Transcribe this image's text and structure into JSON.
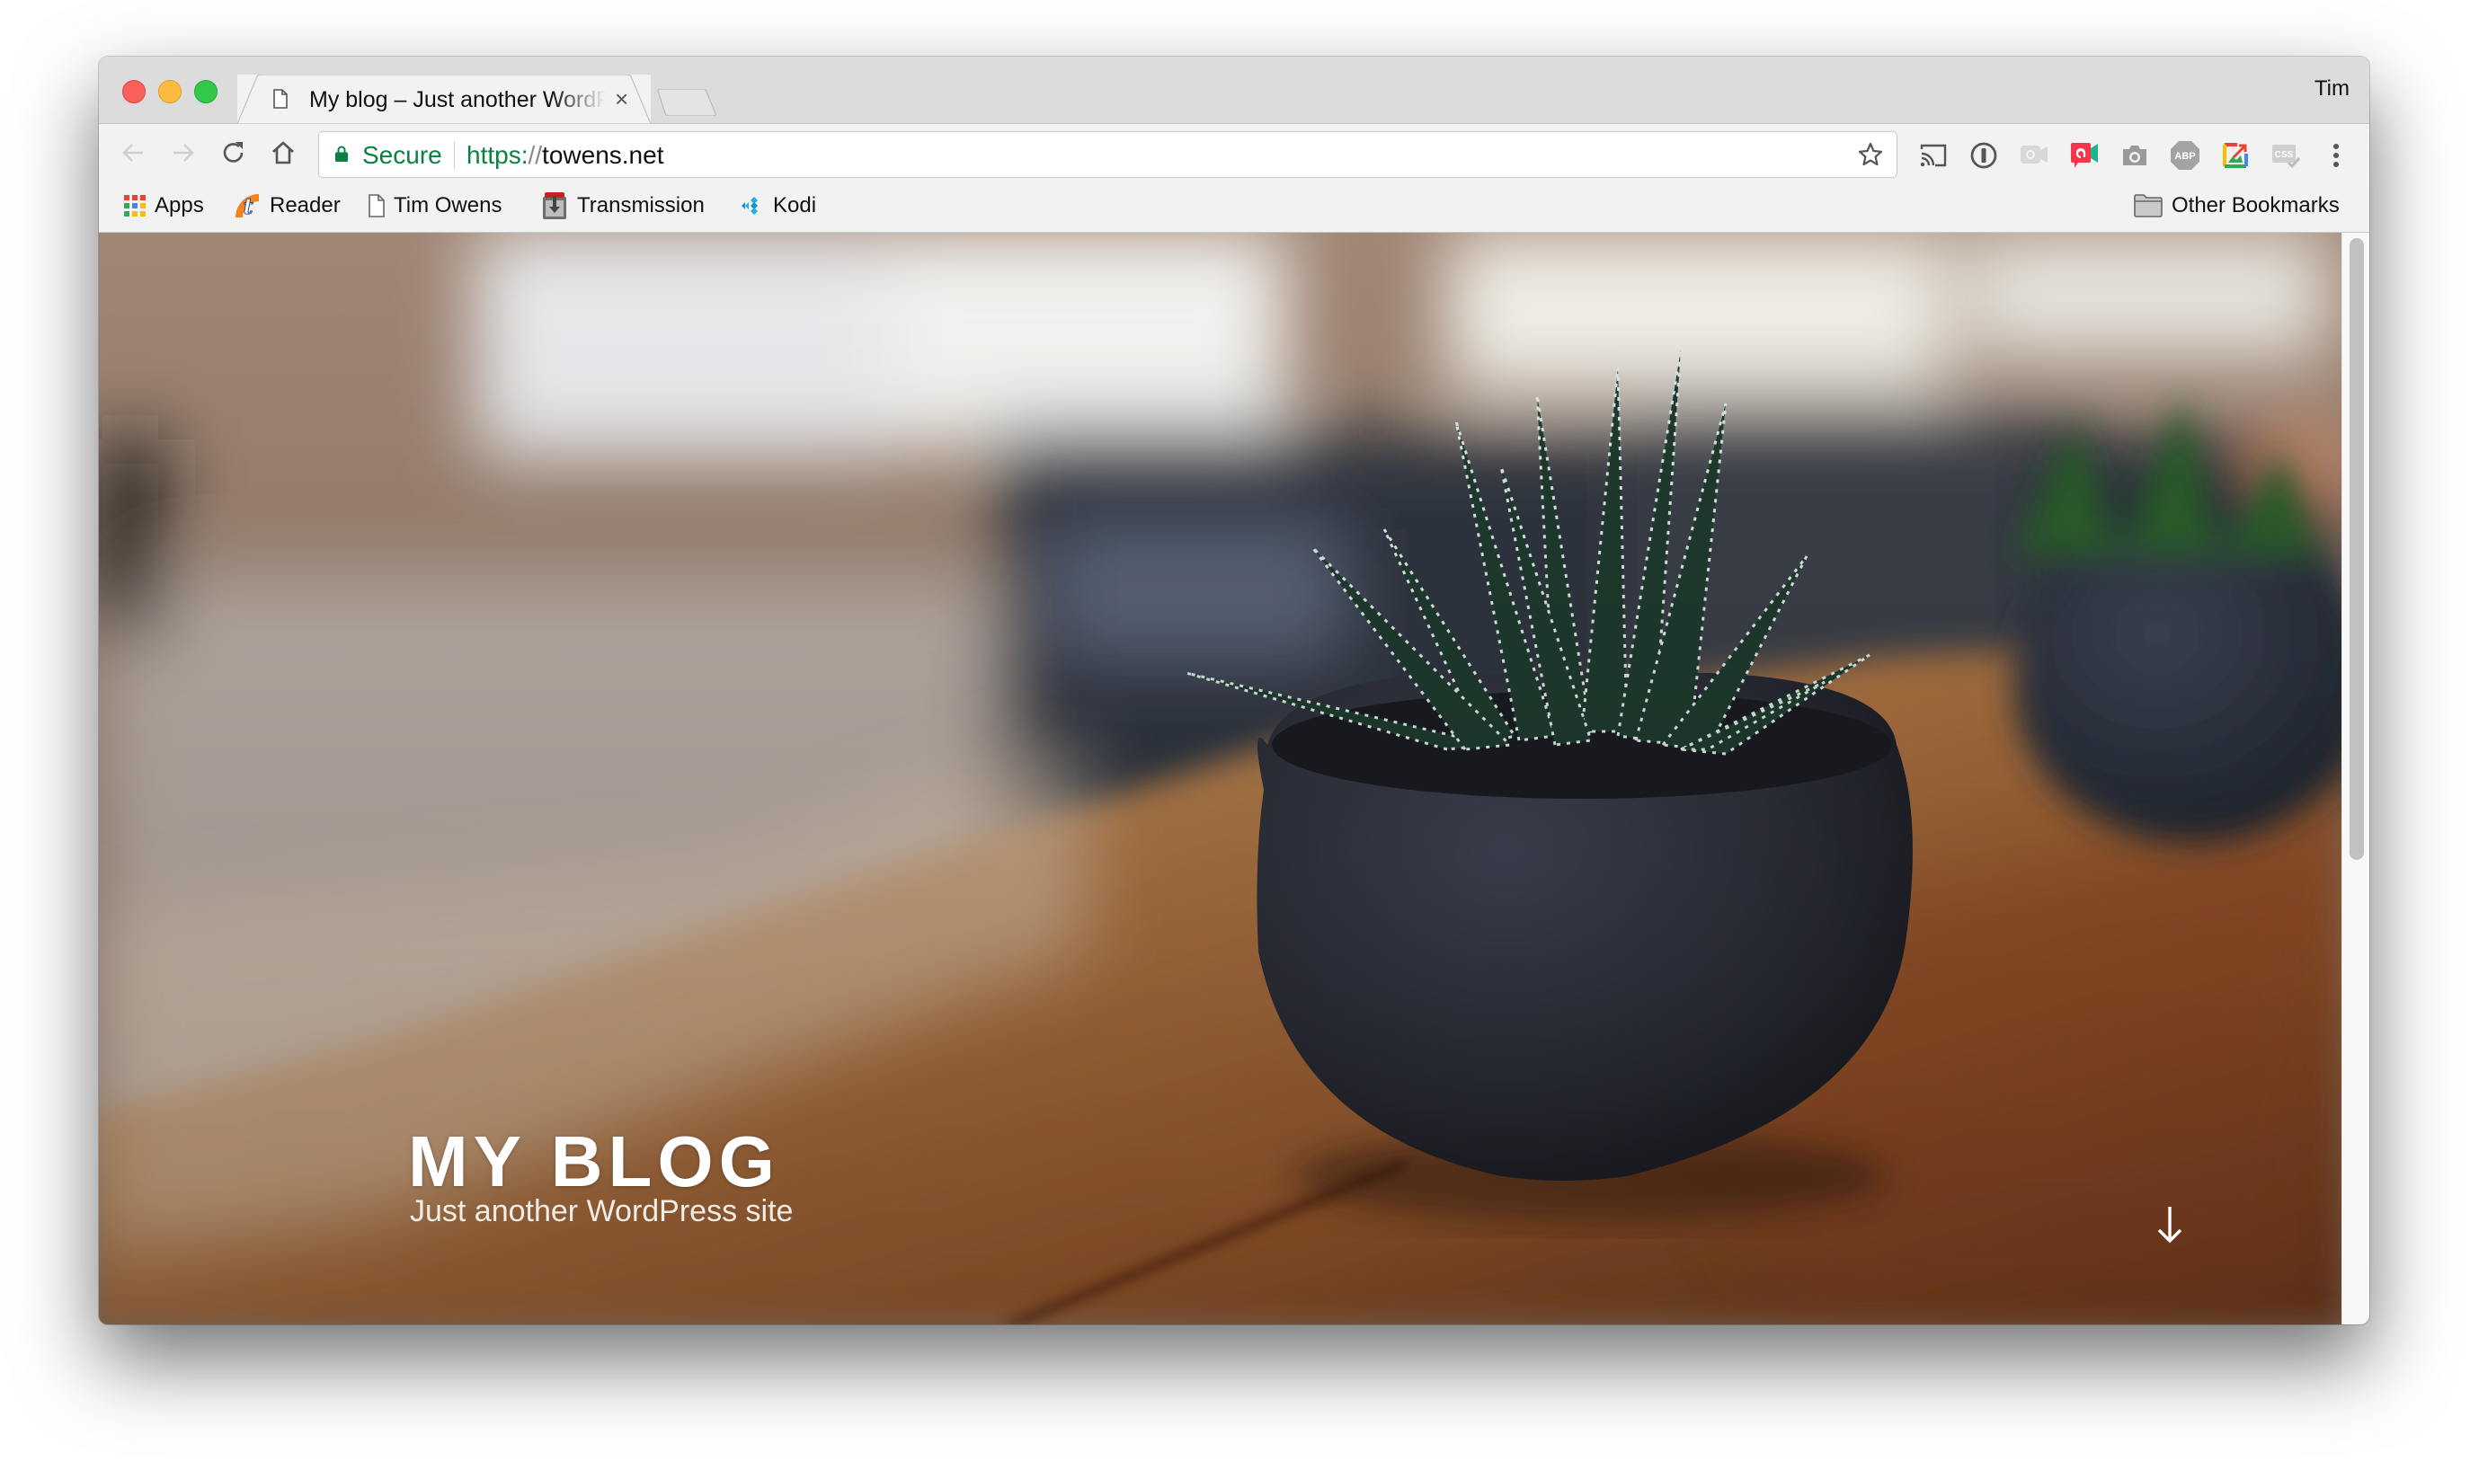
{
  "browser": {
    "tab": {
      "title": "My blog – Just another WordPress site",
      "icon": "document-icon"
    },
    "profile_name": "Tim",
    "toolbar": {
      "back_icon": "arrow-left-icon",
      "forward_icon": "arrow-right-icon",
      "reload_icon": "reload-icon",
      "home_icon": "home-icon",
      "security_label": "Secure",
      "url_scheme": "https:",
      "url_slashes": "//",
      "url_host": "towens.net",
      "extensions": [
        "cast-icon",
        "1password-icon",
        "appear-in-disabled-icon",
        "appear-in-icon",
        "screenshot-camera-icon",
        "adblock-plus-icon",
        "image-editor-icon",
        "css-validator-icon",
        "menu-kebab-icon"
      ]
    },
    "bookmarks": [
      {
        "label": "Apps",
        "icon": "apps-grid-icon"
      },
      {
        "label": "Reader",
        "icon": "tt-rss-reader-icon"
      },
      {
        "label": "Tim Owens",
        "icon": "document-icon"
      },
      {
        "label": "Transmission",
        "icon": "transmission-icon"
      },
      {
        "label": "Kodi",
        "icon": "kodi-icon"
      }
    ],
    "other_bookmarks": {
      "label": "Other Bookmarks",
      "icon": "folder-icon"
    }
  },
  "page": {
    "site_title": "MY BLOG",
    "site_description": "Just another WordPress site",
    "scroll_icon": "arrow-down-icon"
  },
  "colors": {
    "secure_green": "#0b8043",
    "chrome_bg": "#f2f2f2",
    "tabstrip_bg": "#dcdcdc"
  }
}
